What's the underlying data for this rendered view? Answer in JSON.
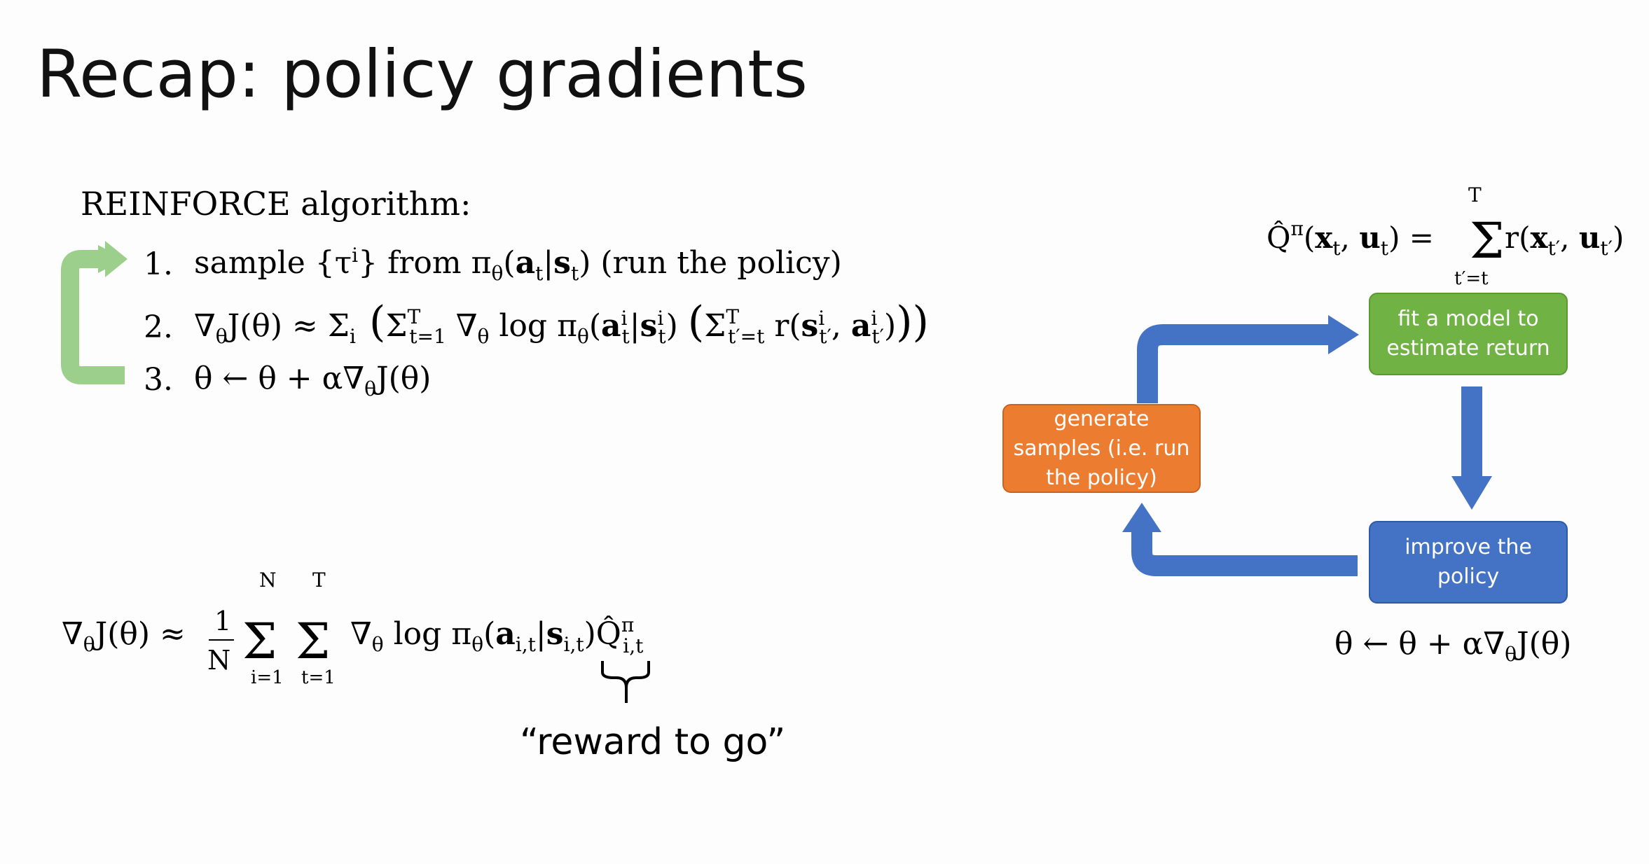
{
  "slide": {
    "title": "Recap: policy gradients",
    "algorithm_label": "REINFORCE algorithm:",
    "steps": [
      {
        "number": "1.",
        "text": "sample {τⁱ} from πθ(at|st) (run the policy)"
      },
      {
        "number": "2.",
        "text": "∇θJ(θ) ≈ Σi ( Σt=1..T ∇θ log πθ(aⁱt|sⁱt) ( Σt′=t..T r(sⁱt′, aⁱt′) ) )"
      },
      {
        "number": "3.",
        "text": "θ ← θ + α∇θJ(θ)"
      }
    ],
    "gradient_estimator": "∇θJ(θ) ≈ (1/N) Σi=1..N Σt=1..T ∇θ log πθ(ai,t|si,t) Q̂πi,t",
    "qhat_definition": "Q̂π(xt, ut) = Σt′=t..T r(xt′, ut′)",
    "reward_to_go_label": "“reward to go”",
    "update_rule": "θ ← θ + α∇θJ(θ)"
  },
  "diagram": {
    "boxes": {
      "fit": "fit a model to estimate return",
      "generate": "generate samples (i.e. run the policy)",
      "improve": "improve the policy"
    },
    "colors": {
      "fit": "#70b243",
      "generate": "#ec7c30",
      "improve": "#4472c4",
      "arrow": "#4472c4",
      "loop_arrow": "#9ccf8c"
    }
  }
}
